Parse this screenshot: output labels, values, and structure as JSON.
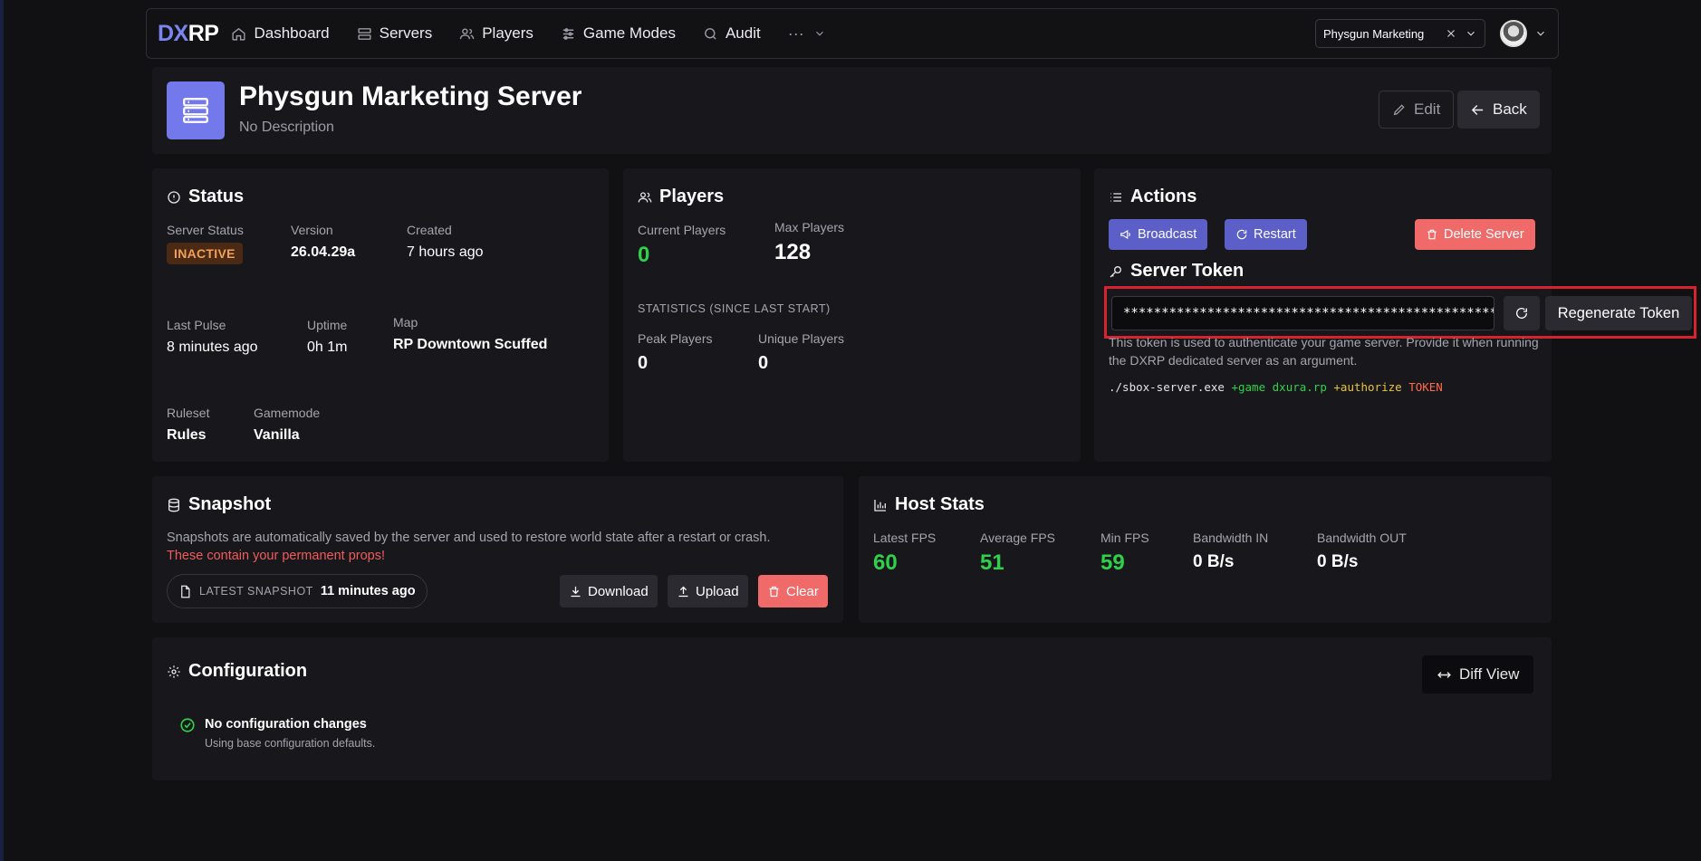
{
  "nav": {
    "logo_a": "DX",
    "logo_b": "RP",
    "items": [
      {
        "label": "Dashboard",
        "icon": "home-icon"
      },
      {
        "label": "Servers",
        "icon": "server-icon"
      },
      {
        "label": "Players",
        "icon": "users-icon"
      },
      {
        "label": "Game Modes",
        "icon": "sliders-icon"
      },
      {
        "label": "Audit",
        "icon": "search-icon"
      }
    ],
    "more": "···",
    "selected_server": "Physgun Marketing"
  },
  "header": {
    "title": "Physgun Marketing Server",
    "description": "No Description",
    "edit_label": "Edit",
    "back_label": "Back"
  },
  "status": {
    "title": "Status",
    "server_status_label": "Server Status",
    "server_status_value": "INACTIVE",
    "version_label": "Version",
    "version_value": "26.04.29a",
    "created_label": "Created",
    "created_value": "7 hours ago",
    "last_pulse_label": "Last Pulse",
    "last_pulse_value": "8 minutes ago",
    "uptime_label": "Uptime",
    "uptime_value": "0h 1m",
    "map_label": "Map",
    "map_value": "RP Downtown Scuffed",
    "ruleset_label": "Ruleset",
    "ruleset_value": "Rules",
    "gamemode_label": "Gamemode",
    "gamemode_value": "Vanilla"
  },
  "players": {
    "title": "Players",
    "current_label": "Current Players",
    "current_value": "0",
    "max_label": "Max Players",
    "max_value": "128",
    "stats_label": "STATISTICS (SINCE LAST START)",
    "peak_label": "Peak Players",
    "peak_value": "0",
    "unique_label": "Unique Players",
    "unique_value": "0"
  },
  "actions": {
    "title": "Actions",
    "broadcast_label": "Broadcast",
    "restart_label": "Restart",
    "delete_label": "Delete Server",
    "token_title": "Server Token",
    "token_value": "****************************************************",
    "regenerate_label": "Regenerate Token",
    "token_help": "This token is used to authenticate your game server. Provide it when running the DXRP dedicated server as an argument.",
    "cmd_exe": "./sbox-server.exe",
    "cmd_game": "+game",
    "cmd_game_val": "dxura.rp",
    "cmd_auth": "+authorize",
    "cmd_token": "TOKEN"
  },
  "snapshot": {
    "title": "Snapshot",
    "description": "Snapshots are automatically saved by the server and used to restore world state after a restart or crash.",
    "warning": "These contain your permanent props!",
    "latest_label": "LATEST SNAPSHOT",
    "latest_value": "11 minutes ago",
    "download_label": "Download",
    "upload_label": "Upload",
    "clear_label": "Clear"
  },
  "host_stats": {
    "title": "Host Stats",
    "latest_fps_label": "Latest FPS",
    "latest_fps_value": "60",
    "avg_fps_label": "Average FPS",
    "avg_fps_value": "51",
    "min_fps_label": "Min FPS",
    "min_fps_value": "59",
    "bw_in_label": "Bandwidth IN",
    "bw_in_value": "0 B/s",
    "bw_out_label": "Bandwidth OUT",
    "bw_out_value": "0 B/s"
  },
  "configuration": {
    "title": "Configuration",
    "diff_label": "Diff View",
    "status_title": "No configuration changes",
    "status_sub": "Using base configuration defaults."
  },
  "colors": {
    "accent": "#7378ea",
    "button_purple": "#5b5fc7",
    "danger": "#f06a6a",
    "success": "#2fd14a",
    "highlight": "#d6232e"
  }
}
